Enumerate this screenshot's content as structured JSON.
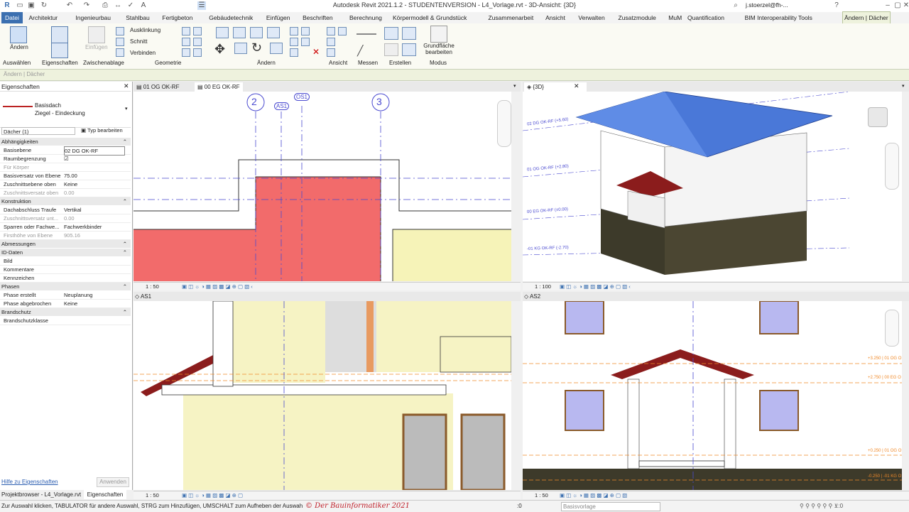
{
  "window": {
    "title": "Autodesk Revit 2021.1.2 - STUDENTENVERSION - L4_Vorlage.rvt - 3D-Ansicht: {3D}",
    "user": "j.stoerzel@fh-..."
  },
  "tabs": [
    "Datei",
    "Architektur",
    "Ingenieurbau",
    "Stahlbau",
    "Fertigbeton",
    "Gebäudetechnik",
    "Einfügen",
    "Beschriften",
    "Berechnung",
    "Körpermodell & Grundstück",
    "Zusammenarbeit",
    "Ansicht",
    "Verwalten",
    "Zusatzmodule",
    "MuM",
    "Quantification",
    "BIM Interoperability Tools",
    "Ändern | Dächer"
  ],
  "ribbon": {
    "aendern": "Ändern",
    "auswaehlen": "Auswählen",
    "eigenschaften": "Eigenschaften",
    "einfuegen": "Einfügen",
    "zwischenablage": "Zwischenablage",
    "ausklinkung": "Ausklinkung",
    "schnitt": "Schnitt",
    "verbinden": "Verbinden",
    "geometrie": "Geometrie",
    "aendern_panel": "Ändern",
    "ansicht": "Ansicht",
    "messen": "Messen",
    "erstellen": "Erstellen",
    "grundflaeche": "Grundfläche bearbeiten",
    "modus": "Modus"
  },
  "context_label": "Ändern | Dächer",
  "properties": {
    "title": "Eigenschaften",
    "family": "Basisdach",
    "type": "Ziegel - Eindeckung",
    "selector": "Dächer (1)",
    "edit_type": "Typ bearbeiten",
    "groups": [
      {
        "name": "Abhängigkeiten",
        "rows": [
          {
            "k": "Basisebene",
            "v": "02 DG OK-RF"
          },
          {
            "k": "Raumbegrenzung",
            "v": "☑"
          },
          {
            "k": "Für Körper",
            "v": ""
          },
          {
            "k": "Basisversatz von Ebene",
            "v": "75.00"
          },
          {
            "k": "Zuschnittsebene oben",
            "v": "Keine"
          },
          {
            "k": "Zuschnittsversatz oben",
            "v": "0.00"
          }
        ]
      },
      {
        "name": "Konstruktion",
        "rows": [
          {
            "k": "Dachabschluss Traufe",
            "v": "Vertikal"
          },
          {
            "k": "Zuschnittsversatz unt...",
            "v": "0.00"
          },
          {
            "k": "Sparren oder Fachwe...",
            "v": "Fachwerkbinder"
          },
          {
            "k": "Firsthöhe von Ebene",
            "v": "905.16"
          }
        ]
      },
      {
        "name": "Abmessungen",
        "rows": []
      },
      {
        "name": "ID-Daten",
        "rows": [
          {
            "k": "Bild",
            "v": ""
          },
          {
            "k": "Kommentare",
            "v": ""
          },
          {
            "k": "Kennzeichen",
            "v": ""
          }
        ]
      },
      {
        "name": "Phasen",
        "rows": [
          {
            "k": "Phase erstellt",
            "v": "Neuplanung"
          },
          {
            "k": "Phase abgebrochen",
            "v": "Keine"
          }
        ]
      },
      {
        "name": "Brandschutz",
        "rows": [
          {
            "k": "Brandschutzklasse",
            "v": ""
          }
        ]
      }
    ],
    "help_link": "Hilfe zu Eigenschaften",
    "apply": "Anwenden"
  },
  "views": {
    "tab1": "01 OG OK-RF",
    "tab2": "00 EG OK-RF",
    "tab3d": "{3D}",
    "as1": "AS1",
    "as2": "AS2",
    "scale_plan": "1 : 50",
    "scale_3d": "1 : 100",
    "scale_as1": "1 : 50",
    "scale_as2": "1 : 50",
    "grid_2": "2",
    "grid_3": "3",
    "as1_tag": "AS1",
    "os1_tag": "OS1",
    "level_3d_1": "02 DG OK-RF (+5.60)",
    "level_3d_2": "01 OG OK-RF (+2.80)",
    "level_3d_3": "00 EG OK-RF (±0.00)",
    "level_3d_4": "-01 KG OK-RF (-2.70)",
    "level_as2_1": "+3.250 | 01 OG O",
    "level_as2_2": "+2.750 | 00 EG O",
    "level_as2_3": "+0.250 | 01 OG O",
    "level_as2_4": "-0.250 | -01 KG O"
  },
  "bottom_tabs": {
    "browser": "Projektbrowser - L4_Vorlage.rvt",
    "props": "Eigenschaften"
  },
  "status": {
    "hint": "Zur Auswahl klicken, TABULATOR für andere Auswahl, STRG zum Hinzufügen, UMSCHALT zum Aufheben der Auswahl.",
    "watermark": "© Der Bauinformatiker 2021",
    "workset_count": ":0",
    "design_option": "Basisvorlage"
  },
  "colors": {
    "accent": "#3b6fb0",
    "roof_red": "#f26b6b",
    "roof_blue": "#4a78d8",
    "dark_base": "#3d3a2a",
    "context_green": "#eef2dd"
  }
}
